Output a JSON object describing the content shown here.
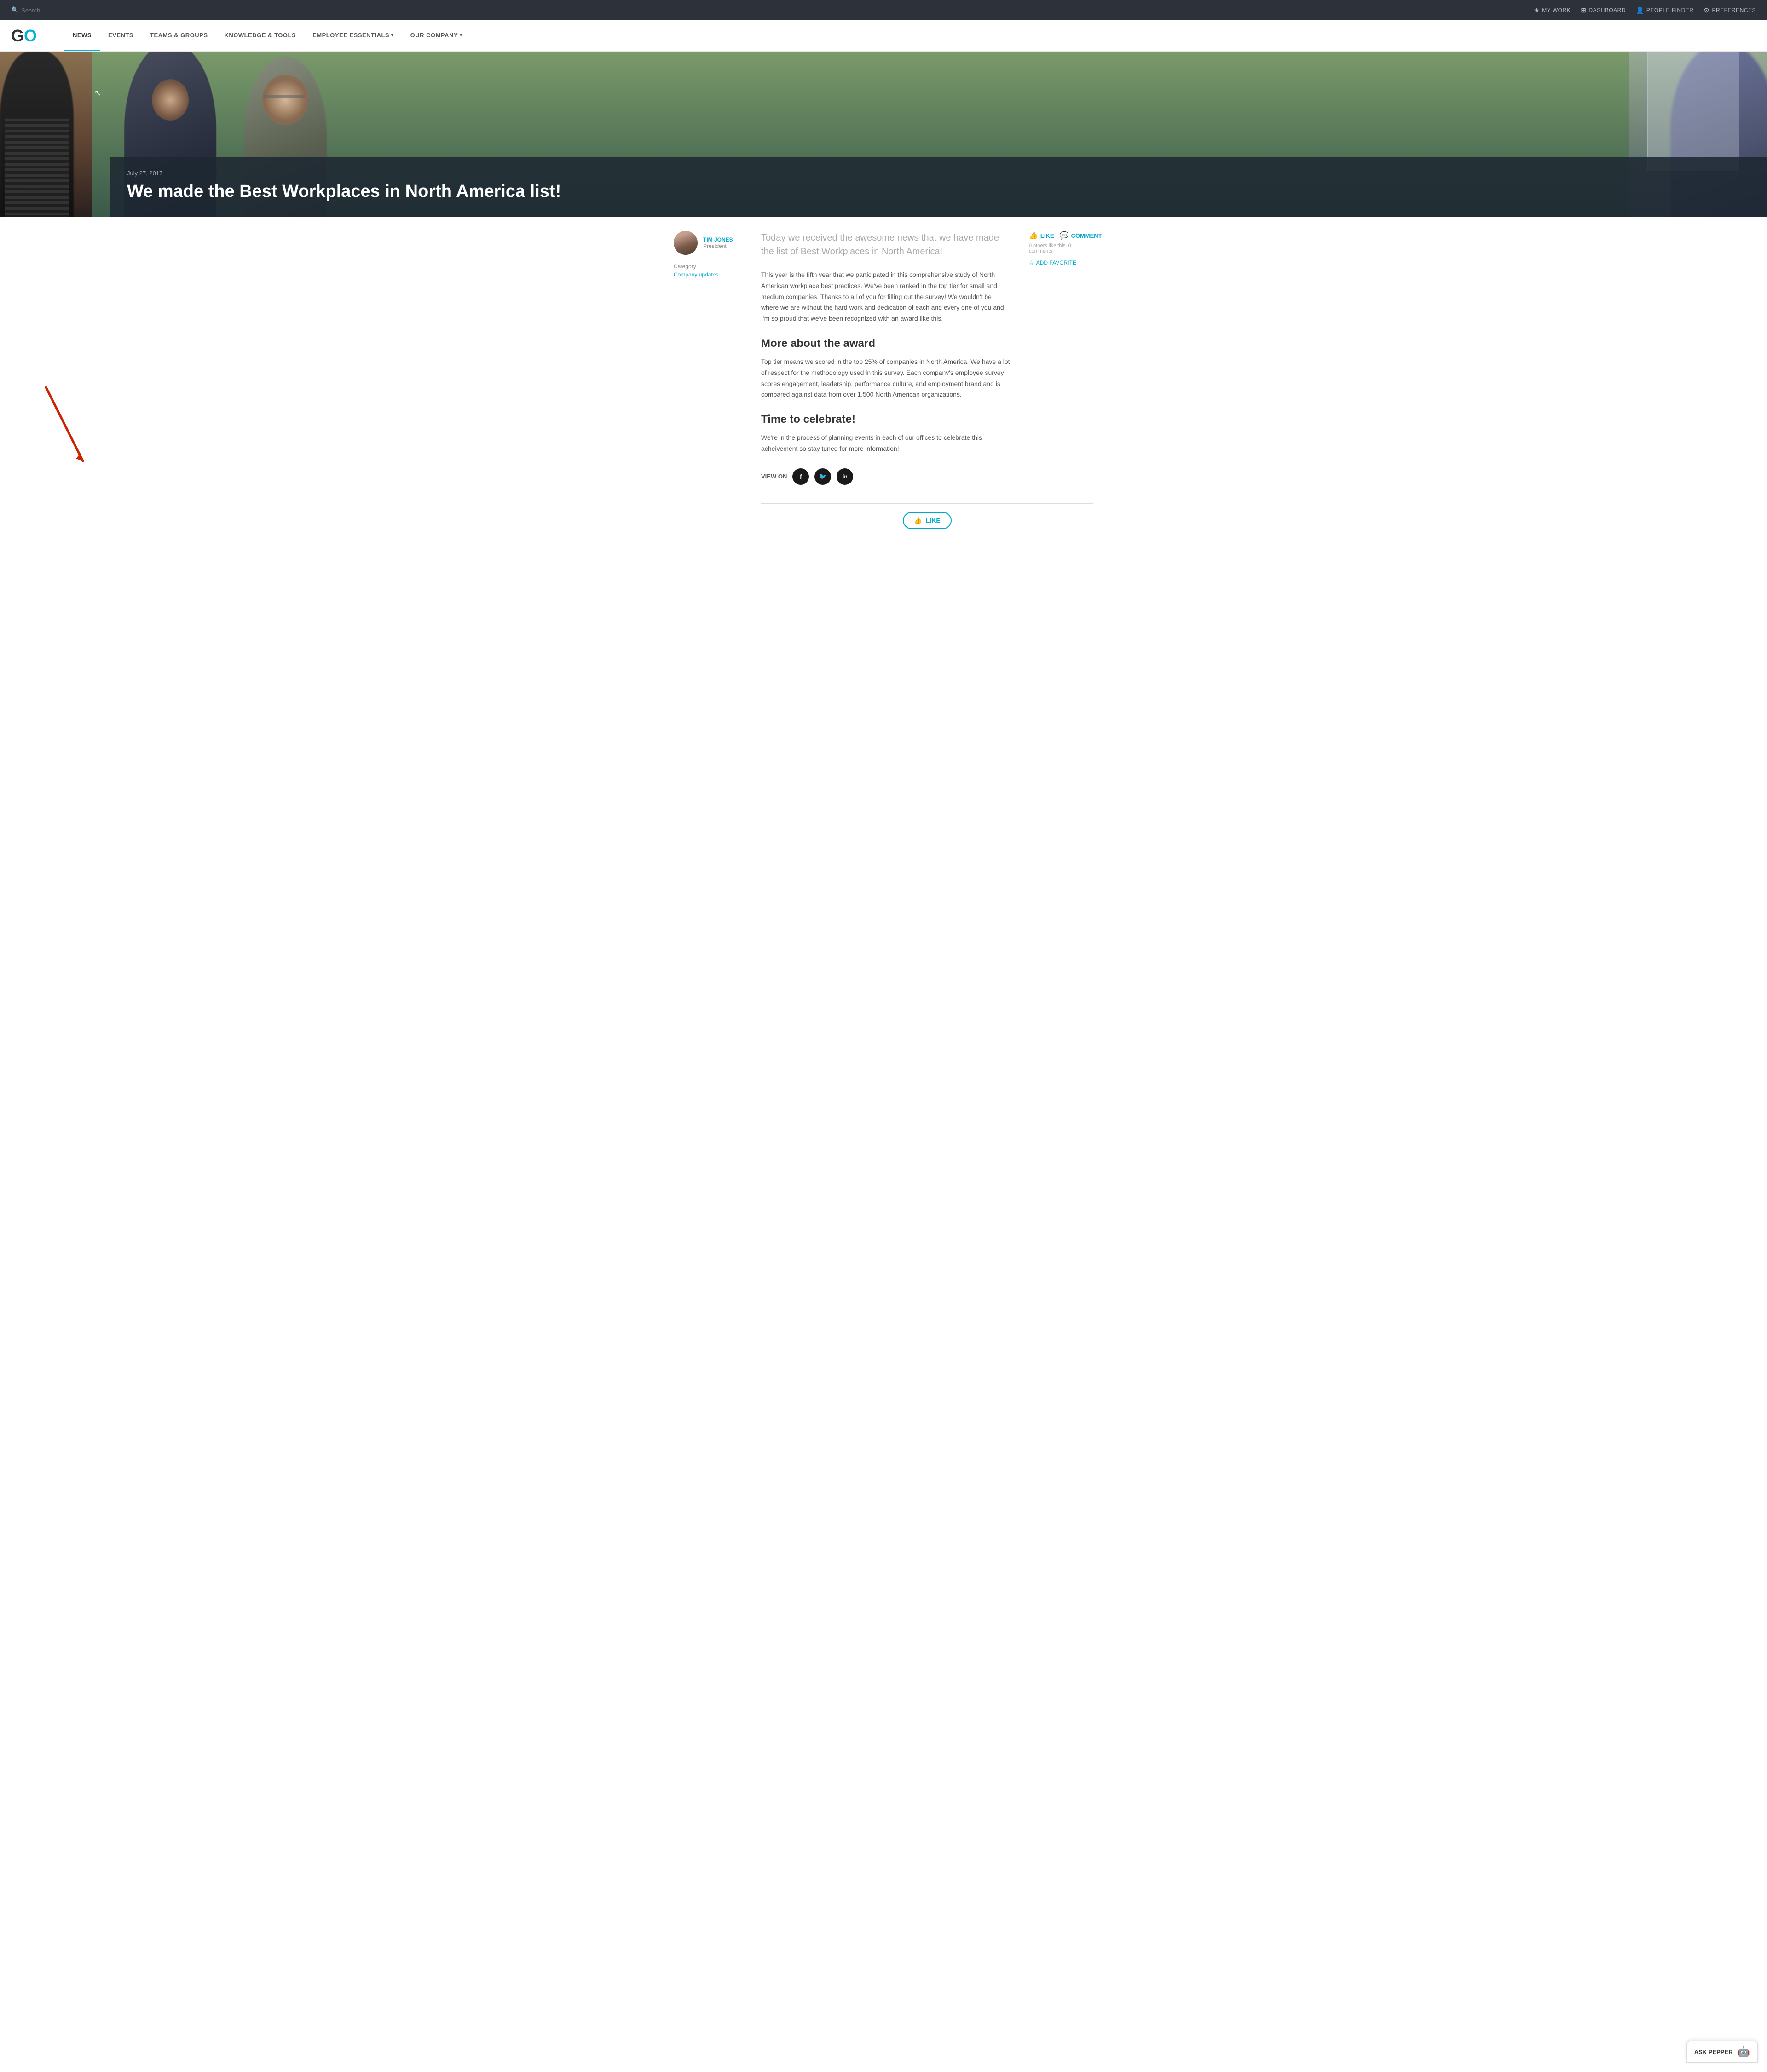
{
  "topbar": {
    "search_placeholder": "Search...",
    "nav_items": [
      {
        "id": "my-work",
        "label": "MY WORK",
        "icon": "★"
      },
      {
        "id": "dashboard",
        "label": "DASHBOARD",
        "icon": "⊞"
      },
      {
        "id": "people-finder",
        "label": "PEOPLE FINDER",
        "icon": "👤"
      },
      {
        "id": "preferences",
        "label": "PREFERENCES",
        "icon": "⚙"
      }
    ]
  },
  "logo": {
    "text_g": "G",
    "text_o": "O"
  },
  "main_nav": {
    "items": [
      {
        "id": "news",
        "label": "NEWS",
        "active": true
      },
      {
        "id": "events",
        "label": "EVENTS",
        "active": false
      },
      {
        "id": "teams-groups",
        "label": "TEAMS & GROUPS",
        "active": false
      },
      {
        "id": "knowledge-tools",
        "label": "KNOWLEDGE & TOOLS",
        "active": false
      },
      {
        "id": "employee-essentials",
        "label": "EMPLOYEE ESSENTIALS",
        "active": false,
        "dropdown": true
      },
      {
        "id": "our-company",
        "label": "OUR COMPANY",
        "active": false,
        "dropdown": true
      }
    ]
  },
  "hero": {
    "date": "July 27, 2017",
    "title": "We made the Best Workplaces in North America list!"
  },
  "author": {
    "name": "TIM JONES",
    "title": "President",
    "avatar_bg": "#7a5a4a"
  },
  "article": {
    "category_label": "Category",
    "category_link": "Company updates",
    "lead": "Today we received the awesome news that we have made the list of Best Workplaces in North America!",
    "body1": "This year is the fifth year that we participated in this comprehensive study of North American workplace best practices. We've been ranked in the top tier for small and medium companies. Thanks to all of you for filling out the survey! We wouldn't be where we are without the hard work and dedication of each and every one of you and I'm so proud that we've been recognized with an award like this.",
    "section1_title": "More about the award",
    "body2": "Top tier means we scored in the top 25% of companies in North America. We have a lot of respect for the methodology used in this survey. Each company's employee survey scores engagement, leadership, performance culture, and employment brand and is compared against data from over 1,500 North American organizations.",
    "section2_title": "Time to celebrate!",
    "body3": "We're in the process of planning events in each of our offices to celebrate this acheivement so stay tuned for more information!",
    "actions": {
      "like_label": "LIKE",
      "comment_label": "COMMENT",
      "others_like": "0 others like this.",
      "comments_count": "0 comments.",
      "add_favorite": "ADD FAVORITE"
    },
    "share": {
      "label": "VIEW ON"
    }
  },
  "bottom_like": {
    "label": "LIKE"
  },
  "ask_pepper": {
    "label": "ASK PEPPER"
  }
}
